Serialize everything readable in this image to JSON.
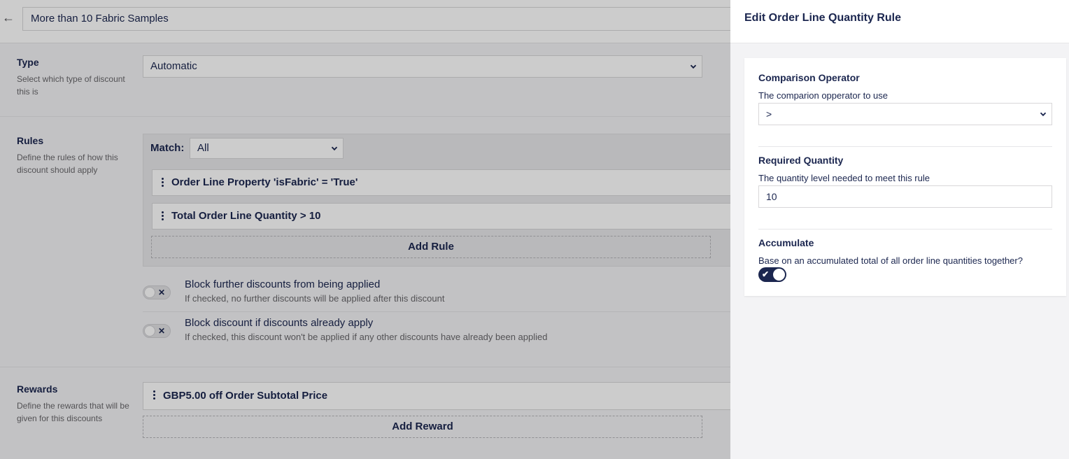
{
  "editor": {
    "discount_name": "More than 10 Fabric Samples",
    "type_section": {
      "title": "Type",
      "description": "Select which type of discount this is",
      "selected": "Automatic"
    },
    "rules_section": {
      "title": "Rules",
      "description": "Define the rules of how this discount should apply",
      "match_label": "Match:",
      "match_value": "All",
      "rules": [
        "Order Line Property 'isFabric' = 'True'",
        "Total Order Line Quantity > 10"
      ],
      "add_rule_label": "Add Rule"
    },
    "options": [
      {
        "title": "Block further discounts from being applied",
        "description": "If checked, no further discounts will be applied after this discount",
        "checked": false
      },
      {
        "title": "Block discount if discounts already apply",
        "description": "If checked, this discount won't be applied if any other discounts have already been applied",
        "checked": false
      }
    ],
    "rewards_section": {
      "title": "Rewards",
      "description": "Define the rewards that will be given for this discounts",
      "rewards": [
        "GBP5.00 off Order Subtotal Price"
      ],
      "add_reward_label": "Add Reward"
    }
  },
  "dialog": {
    "title": "Edit Order Line Quantity Rule",
    "comparison_operator": {
      "label": "Comparison Operator",
      "description": "The comparion opperator to use",
      "value": ">"
    },
    "required_quantity": {
      "label": "Required Quantity",
      "description": "The quantity level needed to meet this rule",
      "value": "10"
    },
    "accumulate": {
      "label": "Accumulate",
      "description": "Base on an accumulated total of all order line quantities together?",
      "checked": true
    }
  },
  "icons": {
    "back": "arrow-left-icon",
    "dropdown": "chevron-down-icon",
    "drag": "drag-handle-icon",
    "toggle_off": "cross-icon",
    "toggle_on": "check-icon"
  },
  "colors": {
    "primary": "#1b264f",
    "muted_text": "#68676b",
    "border": "#d8d7d9",
    "background": "#f3f3f5"
  }
}
